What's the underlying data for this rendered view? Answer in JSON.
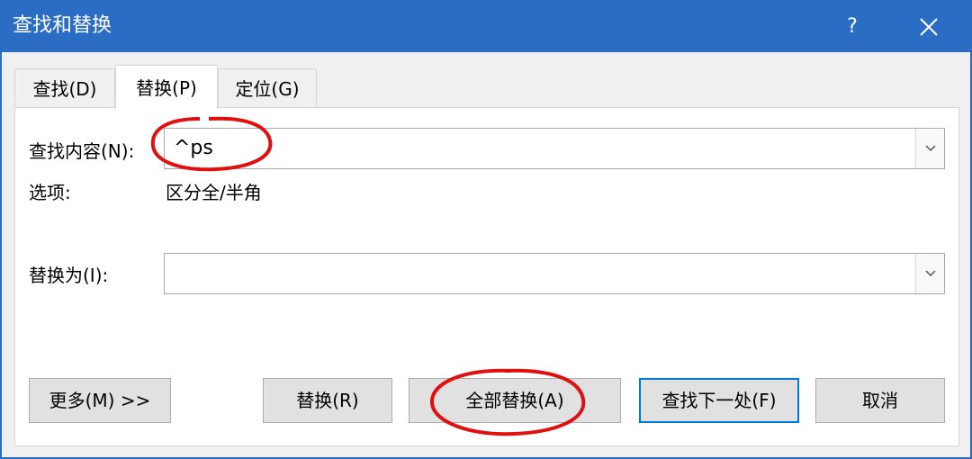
{
  "window": {
    "title": "查找和替换",
    "help_glyph": "?",
    "close_icon": "close-icon"
  },
  "tabs": [
    {
      "label": "查找(D)",
      "active": false
    },
    {
      "label": "替换(P)",
      "active": true
    },
    {
      "label": "定位(G)",
      "active": false
    }
  ],
  "find": {
    "label": "查找内容(N):",
    "value": "^ps",
    "options_label": "选项:",
    "options_value": "区分全/半角"
  },
  "replace": {
    "label": "替换为(I):",
    "value": ""
  },
  "buttons": {
    "more": "更多(M) >>",
    "replace": "替换(R)",
    "replace_all": "全部替换(A)",
    "find_next": "查找下一处(F)",
    "cancel": "取消"
  },
  "colors": {
    "titlebar": "#2b6cc4",
    "annotation": "#e01010",
    "default_button_border": "#0078d7"
  }
}
